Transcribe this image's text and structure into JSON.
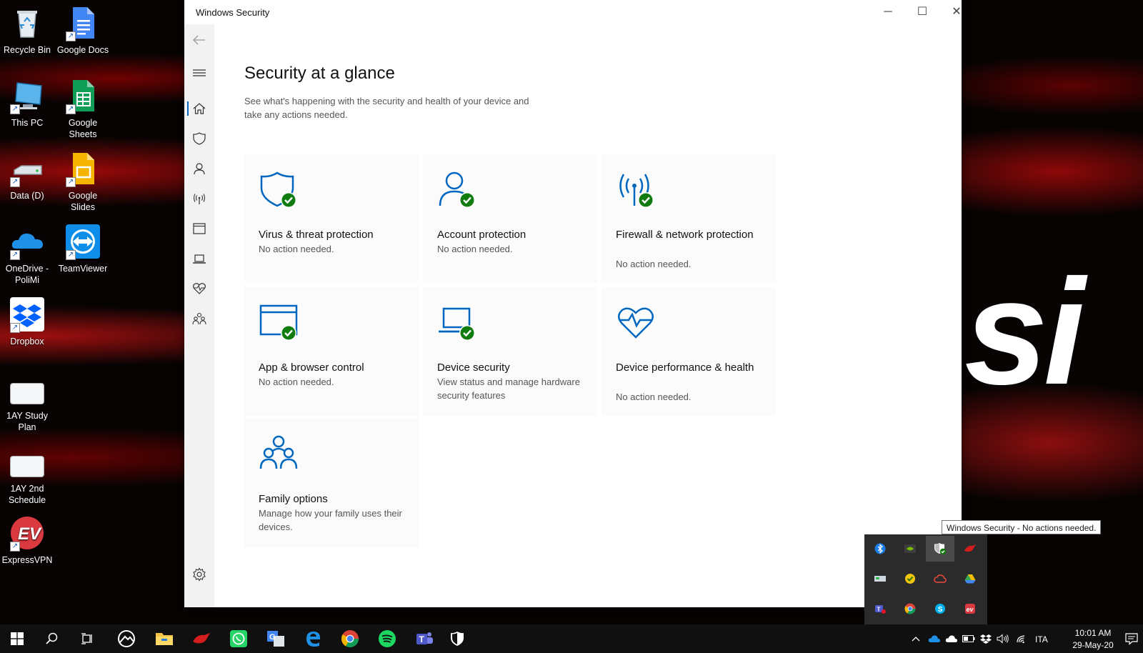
{
  "desktop": {
    "icons": [
      {
        "label": "Recycle Bin"
      },
      {
        "label": "Google Docs"
      },
      {
        "label": "This PC"
      },
      {
        "label": "Google Sheets"
      },
      {
        "label": "Data (D)"
      },
      {
        "label": "Google Slides"
      },
      {
        "label": "OneDrive - PoliMi"
      },
      {
        "label": "TeamViewer"
      },
      {
        "label": "Dropbox"
      },
      {
        "label": "1AY Study Plan"
      },
      {
        "label": "1AY 2nd Schedule"
      },
      {
        "label": "ExpressVPN"
      }
    ]
  },
  "window": {
    "title": "Windows Security",
    "page_title": "Security at a glance",
    "page_subtitle": "See what's happening with the security and health of your device and take any actions needed.",
    "tiles": [
      {
        "name": "Virus & threat protection",
        "status": "No action needed.",
        "icon": "shield-check-icon"
      },
      {
        "name": "Account protection",
        "status": "No action needed.",
        "icon": "person-check-icon"
      },
      {
        "name": "Firewall & network protection",
        "status": "No action needed.",
        "icon": "antenna-check-icon"
      },
      {
        "name": "App & browser control",
        "status": "No action needed.",
        "icon": "browser-check-icon"
      },
      {
        "name": "Device security",
        "status": "View status and manage hardware security features",
        "icon": "laptop-check-icon"
      },
      {
        "name": "Device performance & health",
        "status": "No action needed.",
        "icon": "heart-pulse-icon"
      },
      {
        "name": "Family options",
        "status": "Manage how your family uses their devices.",
        "icon": "family-icon"
      }
    ]
  },
  "tray": {
    "tooltip": "Windows Security - No actions needed.",
    "language": "ITA",
    "time": "10:01 AM",
    "date": "29-May-20"
  },
  "colors": {
    "accent": "#0067c0",
    "ok_green": "#107c10"
  }
}
